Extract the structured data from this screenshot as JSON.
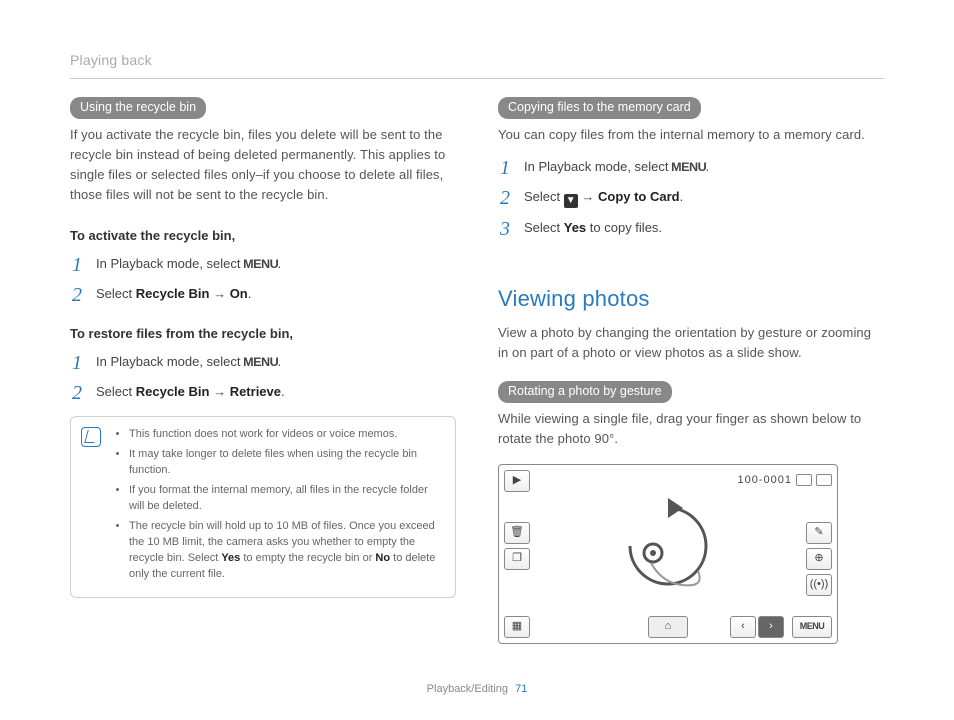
{
  "header": {
    "breadcrumb": "Playing back"
  },
  "left": {
    "pill1": "Using the recycle bin",
    "intro": "If you activate the recycle bin, files you delete will be sent to the recycle bin instead of being deleted permanently. This applies to single files or selected files only–if you choose to delete all files, those files will not be sent to the recycle bin.",
    "sub1": "To activate the recycle bin,",
    "steps1": {
      "s1a": "In Playback mode, select ",
      "s1b": ".",
      "s2a": "Select ",
      "s2b": "Recycle Bin",
      "s2c": " → ",
      "s2d": "On",
      "s2e": "."
    },
    "sub2": "To restore files from the recycle bin,",
    "steps2": {
      "s1a": "In Playback mode, select ",
      "s1b": ".",
      "s2a": "Select ",
      "s2b": "Recycle Bin",
      "s2c": " → ",
      "s2d": "Retrieve",
      "s2e": "."
    },
    "notes": {
      "n1": "This function does not work for videos or voice memos.",
      "n2": "It may take longer to delete files when using the recycle bin function.",
      "n3": "If you format the internal memory, all files in the recycle folder will be deleted.",
      "n4a": "The recycle bin will hold up to 10 MB of files. Once you exceed the 10 MB limit, the camera asks you whether to empty the recycle bin. Select ",
      "n4b": "Yes",
      "n4c": " to empty the recycle bin or ",
      "n4d": "No",
      "n4e": " to delete only the current file."
    }
  },
  "right": {
    "pill2": "Copying files to the memory card",
    "intro2": "You can copy files from the internal memory to a memory card.",
    "stepsC": {
      "s1a": "In Playback mode, select ",
      "s1b": ".",
      "s2a": "Select ",
      "s2b": " → ",
      "s2c": "Copy to Card",
      "s2d": ".",
      "s3a": "Select ",
      "s3b": "Yes",
      "s3c": " to copy files."
    },
    "sectionTitle": "Viewing photos",
    "sectionIntro": "View a photo by changing the orientation by gesture or zooming in on part of a photo or view photos as a slide show.",
    "pill3": "Rotating a photo by gesture",
    "rotateText": "While viewing a single file, drag your finger as shown below to rotate the photo 90°.",
    "screen": {
      "counter": "100-0001",
      "menu": "MENU"
    }
  },
  "glyphs": {
    "menu": "MENU",
    "chevDown": "▼",
    "play": "▶",
    "trash": "✕",
    "left": "‹",
    "right": "›"
  },
  "footer": {
    "section": "Playback/Editing",
    "page": "71"
  }
}
